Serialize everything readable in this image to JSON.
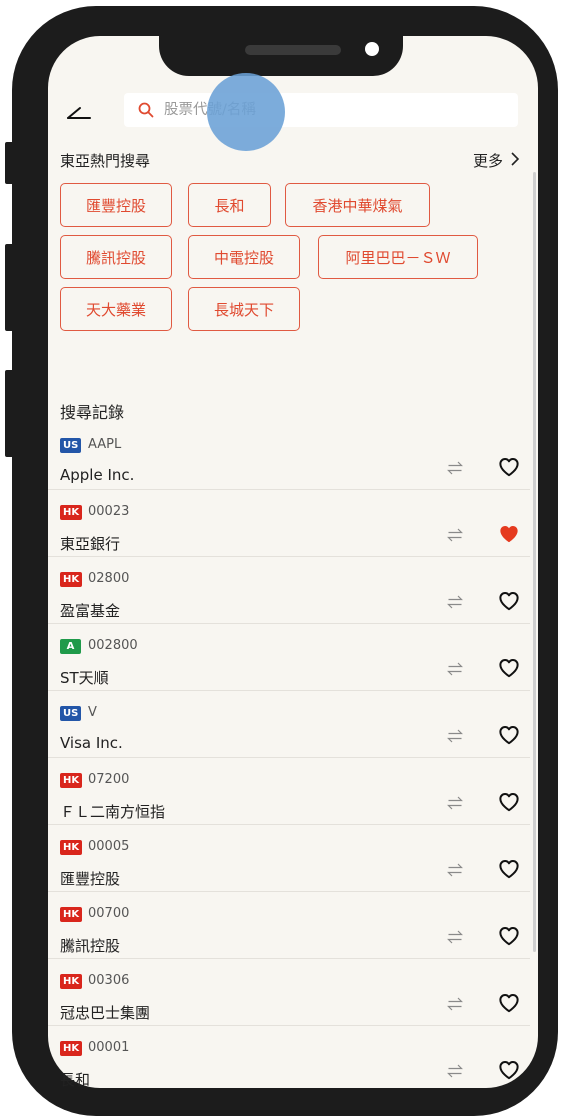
{
  "search": {
    "placeholder": "股票代號/名稱"
  },
  "hot": {
    "title": "東亞熱門搜尋",
    "more_label": "更多",
    "chips": [
      "匯豐控股",
      "長和",
      "香港中華煤氣",
      "騰訊控股",
      "中電控股",
      "阿里巴巴－ＳＷ",
      "天大藥業",
      "長城天下"
    ]
  },
  "history": {
    "title": "搜尋記錄",
    "items": [
      {
        "market": "US",
        "code": "AAPL",
        "name": "Apple Inc.",
        "favorite": false
      },
      {
        "market": "HK",
        "code": "00023",
        "name": "東亞銀行",
        "favorite": true
      },
      {
        "market": "HK",
        "code": "02800",
        "name": "盈富基金",
        "favorite": false
      },
      {
        "market": "A",
        "code": "002800",
        "name": "ST天順",
        "favorite": false
      },
      {
        "market": "US",
        "code": "V",
        "name": "Visa Inc.",
        "favorite": false
      },
      {
        "market": "HK",
        "code": "07200",
        "name": "ＦＬ二南方恒指",
        "favorite": false
      },
      {
        "market": "HK",
        "code": "00005",
        "name": "匯豐控股",
        "favorite": false
      },
      {
        "market": "HK",
        "code": "00700",
        "name": "騰訊控股",
        "favorite": false
      },
      {
        "market": "HK",
        "code": "00306",
        "name": "冠忠巴士集團",
        "favorite": false
      },
      {
        "market": "HK",
        "code": "00001",
        "name": "長和",
        "favorite": false
      }
    ]
  },
  "colors": {
    "accent": "#e04a30",
    "badge_us": "#2356a8",
    "badge_hk": "#d9261c",
    "badge_a": "#1f9a4a",
    "heart_filled": "#e53a1f"
  }
}
